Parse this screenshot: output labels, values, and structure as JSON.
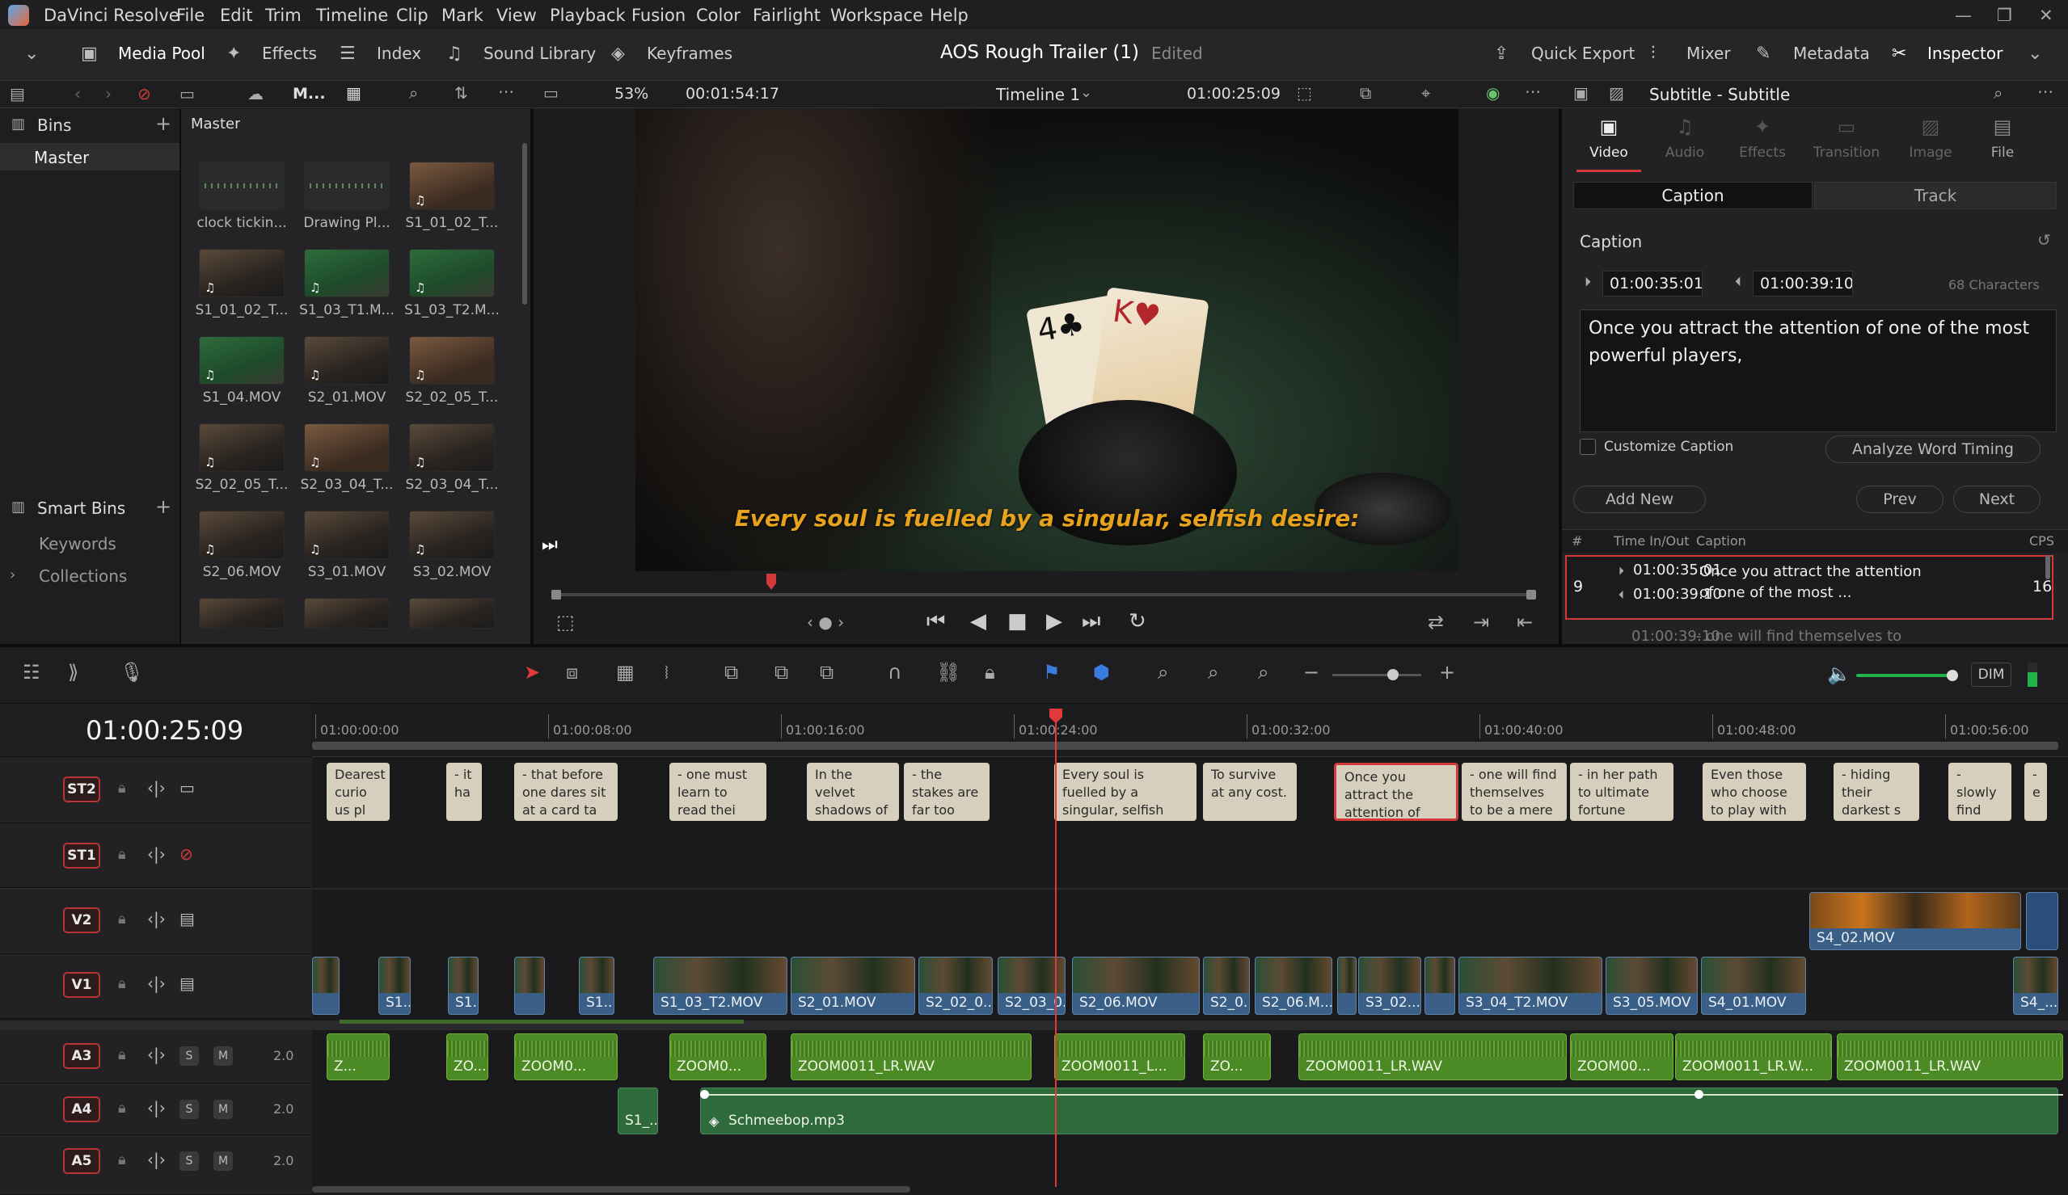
{
  "app": {
    "name": "DaVinci Resolve"
  },
  "menu": [
    "File",
    "Edit",
    "Trim",
    "Timeline",
    "Clip",
    "Mark",
    "View",
    "Playback",
    "Fusion",
    "Color",
    "Fairlight",
    "Workspace",
    "Help"
  ],
  "toolbar": {
    "media_pool": "Media Pool",
    "effects": "Effects",
    "index": "Index",
    "sound_library": "Sound Library",
    "keyframes": "Keyframes",
    "project_title": "AOS Rough Trailer (1)",
    "edited": "Edited",
    "quick_export": "Quick Export",
    "mixer": "Mixer",
    "metadata": "Metadata",
    "inspector": "Inspector"
  },
  "secbar": {
    "view_label": "M...",
    "zoom": "53%",
    "source_timecode": "00:01:54:17",
    "timeline_name": "Timeline 1",
    "timeline_timecode": "01:00:25:09",
    "inspector_title": "Subtitle - Subtitle"
  },
  "bins": {
    "header": "Bins",
    "items": [
      "Master"
    ],
    "smart_bins": "Smart Bins",
    "smart_items": [
      "Keywords",
      "Collections"
    ]
  },
  "media_pool": {
    "title": "Master",
    "clips": [
      "clock tickin...",
      "Drawing Pl...",
      "S1_01_02_T...",
      "S1_01_02_T...",
      "S1_03_T1.M...",
      "S1_03_T2.M...",
      "S1_04.MOV",
      "S2_01.MOV",
      "S2_02_05_T...",
      "S2_02_05_T...",
      "S2_03_04_T...",
      "S2_03_04_T...",
      "S2_06.MOV",
      "S3_01.MOV",
      "S3_02.MOV"
    ]
  },
  "viewer": {
    "subtitle": "Every soul is fuelled by a singular, selfish desire:"
  },
  "inspector": {
    "tabs": [
      "Video",
      "Audio",
      "Effects",
      "Transition",
      "Image",
      "File"
    ],
    "active_tab": "Video",
    "subtabs": [
      "Caption",
      "Track"
    ],
    "section": "Caption",
    "start_tc": "01:00:35:01",
    "end_tc": "01:00:39:10",
    "char_count": "68 Characters",
    "caption_text": "Once you attract the attention of one of the most powerful players,",
    "customize_caption": "Customize Caption",
    "analyze": "Analyze Word Timing",
    "add_new": "Add New",
    "prev": "Prev",
    "next": "Next",
    "list_headers": [
      "#",
      "Time In/Out",
      "Caption",
      "CPS"
    ],
    "row": {
      "num": "9",
      "in": "01:00:35:01",
      "out": "01:00:39:10",
      "caption": "Once you attract the attention of one of the most ...",
      "cps": "16"
    },
    "next_row_in": "01:00:39:10",
    "next_row_caption": "- one will find themselves to"
  },
  "timeline": {
    "timecode": "01:00:25:09",
    "ruler": [
      "01:00:00:00",
      "01:00:08:00",
      "01:00:16:00",
      "01:00:24:00",
      "01:00:32:00",
      "01:00:40:00",
      "01:00:48:00",
      "01:00:56:00"
    ],
    "tracks": {
      "st2": "ST2",
      "st1": "ST1",
      "v2": "V2",
      "v1": "V1",
      "a3": "A3",
      "a4": "A4",
      "a5": "A5"
    },
    "audio_levels": [
      "2.0",
      "2.0",
      "2.0"
    ],
    "s_label": "S",
    "m_label": "M",
    "dim": "DIM",
    "subtitles": [
      "Dearest curio us pl",
      "- it ha",
      "- that before one dares sit at a card ta",
      "- one must learn to read thei",
      "In the velvet shadows of Macau's u",
      "- the stakes are far too high to risk a losing ha",
      "Every soul is fuelled by a singular, selfish",
      "To survive at any cost.",
      "Once you attract the attention of one of",
      "- one will find themselves to be a mere p",
      "- in her path to ultimate fortune",
      "Even those who choose to play with a di",
      "- hiding their darkest s",
      "- slowly find that in this",
      "- e"
    ],
    "v2_clip": "S4_02.MOV",
    "v1_clips": [
      "S1...",
      "S1...",
      "S1...",
      "S1_03_T2.MOV",
      "S2_01.MOV",
      "S2_02_0...",
      "S2_03_0...",
      "S2_06.MOV",
      "S2_0...",
      "S2_06.M...",
      "S3_02....",
      "S3_04_T2.MOV",
      "S3_05.MOV",
      "S4_01.MOV",
      "S4_..."
    ],
    "a3_clips": [
      "Z...",
      "ZO...",
      "ZOOM0...",
      "ZOOM0...",
      "ZOOM0011_LR.WAV",
      "ZOOM0011_L...",
      "ZO...",
      "ZOOM0011_LR.WAV",
      "ZOOM00...",
      "ZOOM0011_LR.W...",
      "ZOOM0011_LR.WAV"
    ],
    "a4_clips": [
      "S1_...",
      "Schmeebop.mp3"
    ]
  },
  "colors": {
    "accent_red": "#d23a3a",
    "subtitle_yellow": "#e6a21c",
    "video_clip": "#3a5f87",
    "audio_clip": "#4c8a26"
  }
}
